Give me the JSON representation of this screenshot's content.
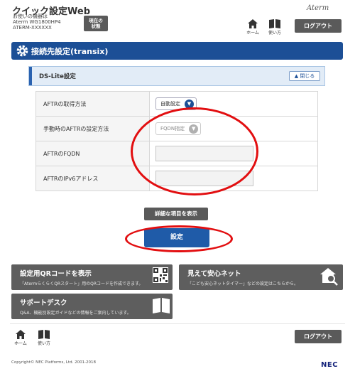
{
  "header": {
    "app_title": "クイック設定Web",
    "device_label": "お使いの機器は",
    "device_model": "Aterm WG1800HP4",
    "device_id": "ATERM-XXXXXX",
    "status_button_line1": "現在の",
    "status_button_line2": "状態",
    "brand": "Aterm",
    "home_label": "ホーム",
    "howto_label": "使い方",
    "logout_label": "ログアウト"
  },
  "section": {
    "title": "接続先設定(transix)"
  },
  "panel": {
    "title": "DS-Lite設定",
    "collapse_label": "閉じる"
  },
  "settings": {
    "rows": [
      {
        "label": "AFTRの取得方法",
        "select": "自動設定"
      },
      {
        "label": "手動時のAFTRの設定方法",
        "select": "FQDN指定"
      },
      {
        "label": "AFTRのFQDN",
        "input": ""
      },
      {
        "label": "AFTRのIPv6アドレス",
        "input": ""
      }
    ]
  },
  "buttons": {
    "detail": "詳細な項目を表示",
    "submit": "設定"
  },
  "cards": [
    {
      "title": "設定用QRコードを表示",
      "desc": "「AtermらくらくQRスタート」用のQRコードを作成できます。",
      "icon": "qr-code-icon"
    },
    {
      "title": "見えて安心ネット",
      "desc": "「こども安心ネットタイマー」などの設定はこちらから。",
      "icon": "home-search-icon"
    },
    {
      "title": "サポートデスク",
      "desc": "Q&A、機能別設定ガイドなどの情報をご案内しています。",
      "icon": "book-icon"
    }
  ],
  "footer": {
    "home_label": "ホーム",
    "howto_label": "使い方",
    "logout_label": "ログアウト",
    "copyright": "Copyright© NEC Platforms, Ltd. 2001-2018",
    "vendor_logo": "NEC"
  },
  "colors": {
    "primary": "#1c4f96",
    "button_gray": "#5a5a5a",
    "annotation_red": "#e20e10",
    "panel_bg": "#e2ecf7"
  }
}
